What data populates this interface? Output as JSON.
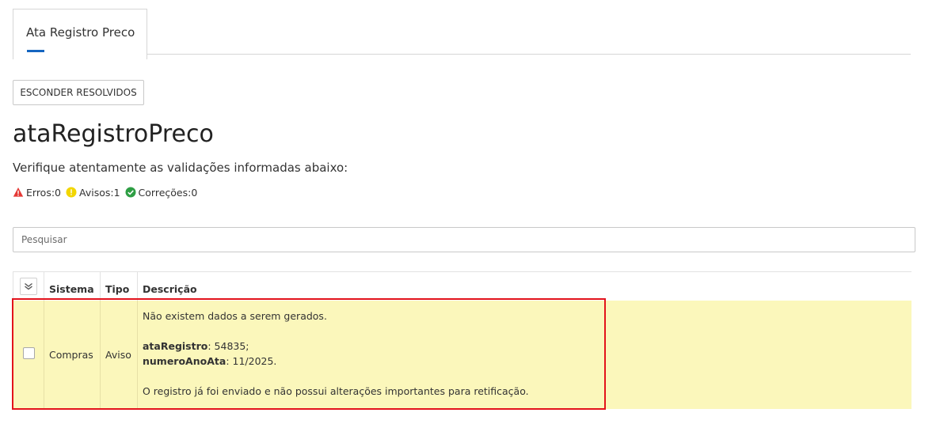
{
  "tabs": [
    {
      "label": "Ata Registro Preco"
    }
  ],
  "toolbar": {
    "hide_resolved_label": "ESCONDER RESOLVIDOS"
  },
  "page": {
    "title": "ataRegistroPreco",
    "subtitle": "Verifique atentamente as validações informadas abaixo:"
  },
  "counters": {
    "errors": "Erros:0",
    "warnings": "Avisos:1",
    "corrections": "Correções:0",
    "colors": {
      "error": "#e53935",
      "warning": "#f2d600",
      "correction": "#2e9e44"
    }
  },
  "search": {
    "placeholder": "Pesquisar",
    "value": ""
  },
  "table": {
    "columns": {
      "sistema": "Sistema",
      "tipo": "Tipo",
      "descricao": "Descrição"
    },
    "rows": [
      {
        "sistema": "Compras",
        "tipo": "Aviso",
        "line1": "Não existem dados a serem gerados.",
        "field1_label": "ataRegistro",
        "field1_value": ": 54835;",
        "field2_label": "numeroAnoAta",
        "field2_value": ": 11/2025.",
        "line_last": "O registro já foi enviado e não possui alterações importantes para retificação."
      }
    ]
  },
  "colors": {
    "accent": "#1565c0",
    "row_warning_bg": "#fbf7bb",
    "highlight_border": "#e3131b"
  }
}
